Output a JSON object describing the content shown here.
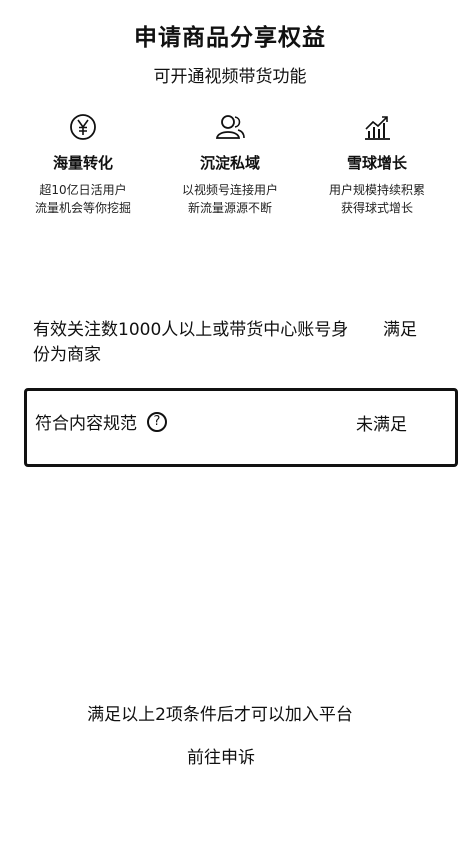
{
  "header": {
    "title": "申请商品分享权益",
    "subtitle": "可开通视频带货功能"
  },
  "benefits": [
    {
      "icon": "yuan-icon",
      "name": "海量转化",
      "desc_line1": "超10亿日活用户",
      "desc_line2": "流量机会等你挖掘"
    },
    {
      "icon": "users-icon",
      "name": "沉淀私域",
      "desc_line1": "以视频号连接用户",
      "desc_line2": "新流量源源不断"
    },
    {
      "icon": "growth-chart-icon",
      "name": "雪球增长",
      "desc_line1": "用户规模持续积累",
      "desc_line2": "获得球式增长"
    }
  ],
  "conditions": [
    {
      "text": "有效关注数1000人以上或带货中心账号身份为商家",
      "status": "满足"
    },
    {
      "text": "符合内容规范",
      "help": "?",
      "status": "未满足"
    }
  ],
  "footer": {
    "note": "满足以上2项条件后才可以加入平台",
    "appeal_link": "前往申诉"
  }
}
